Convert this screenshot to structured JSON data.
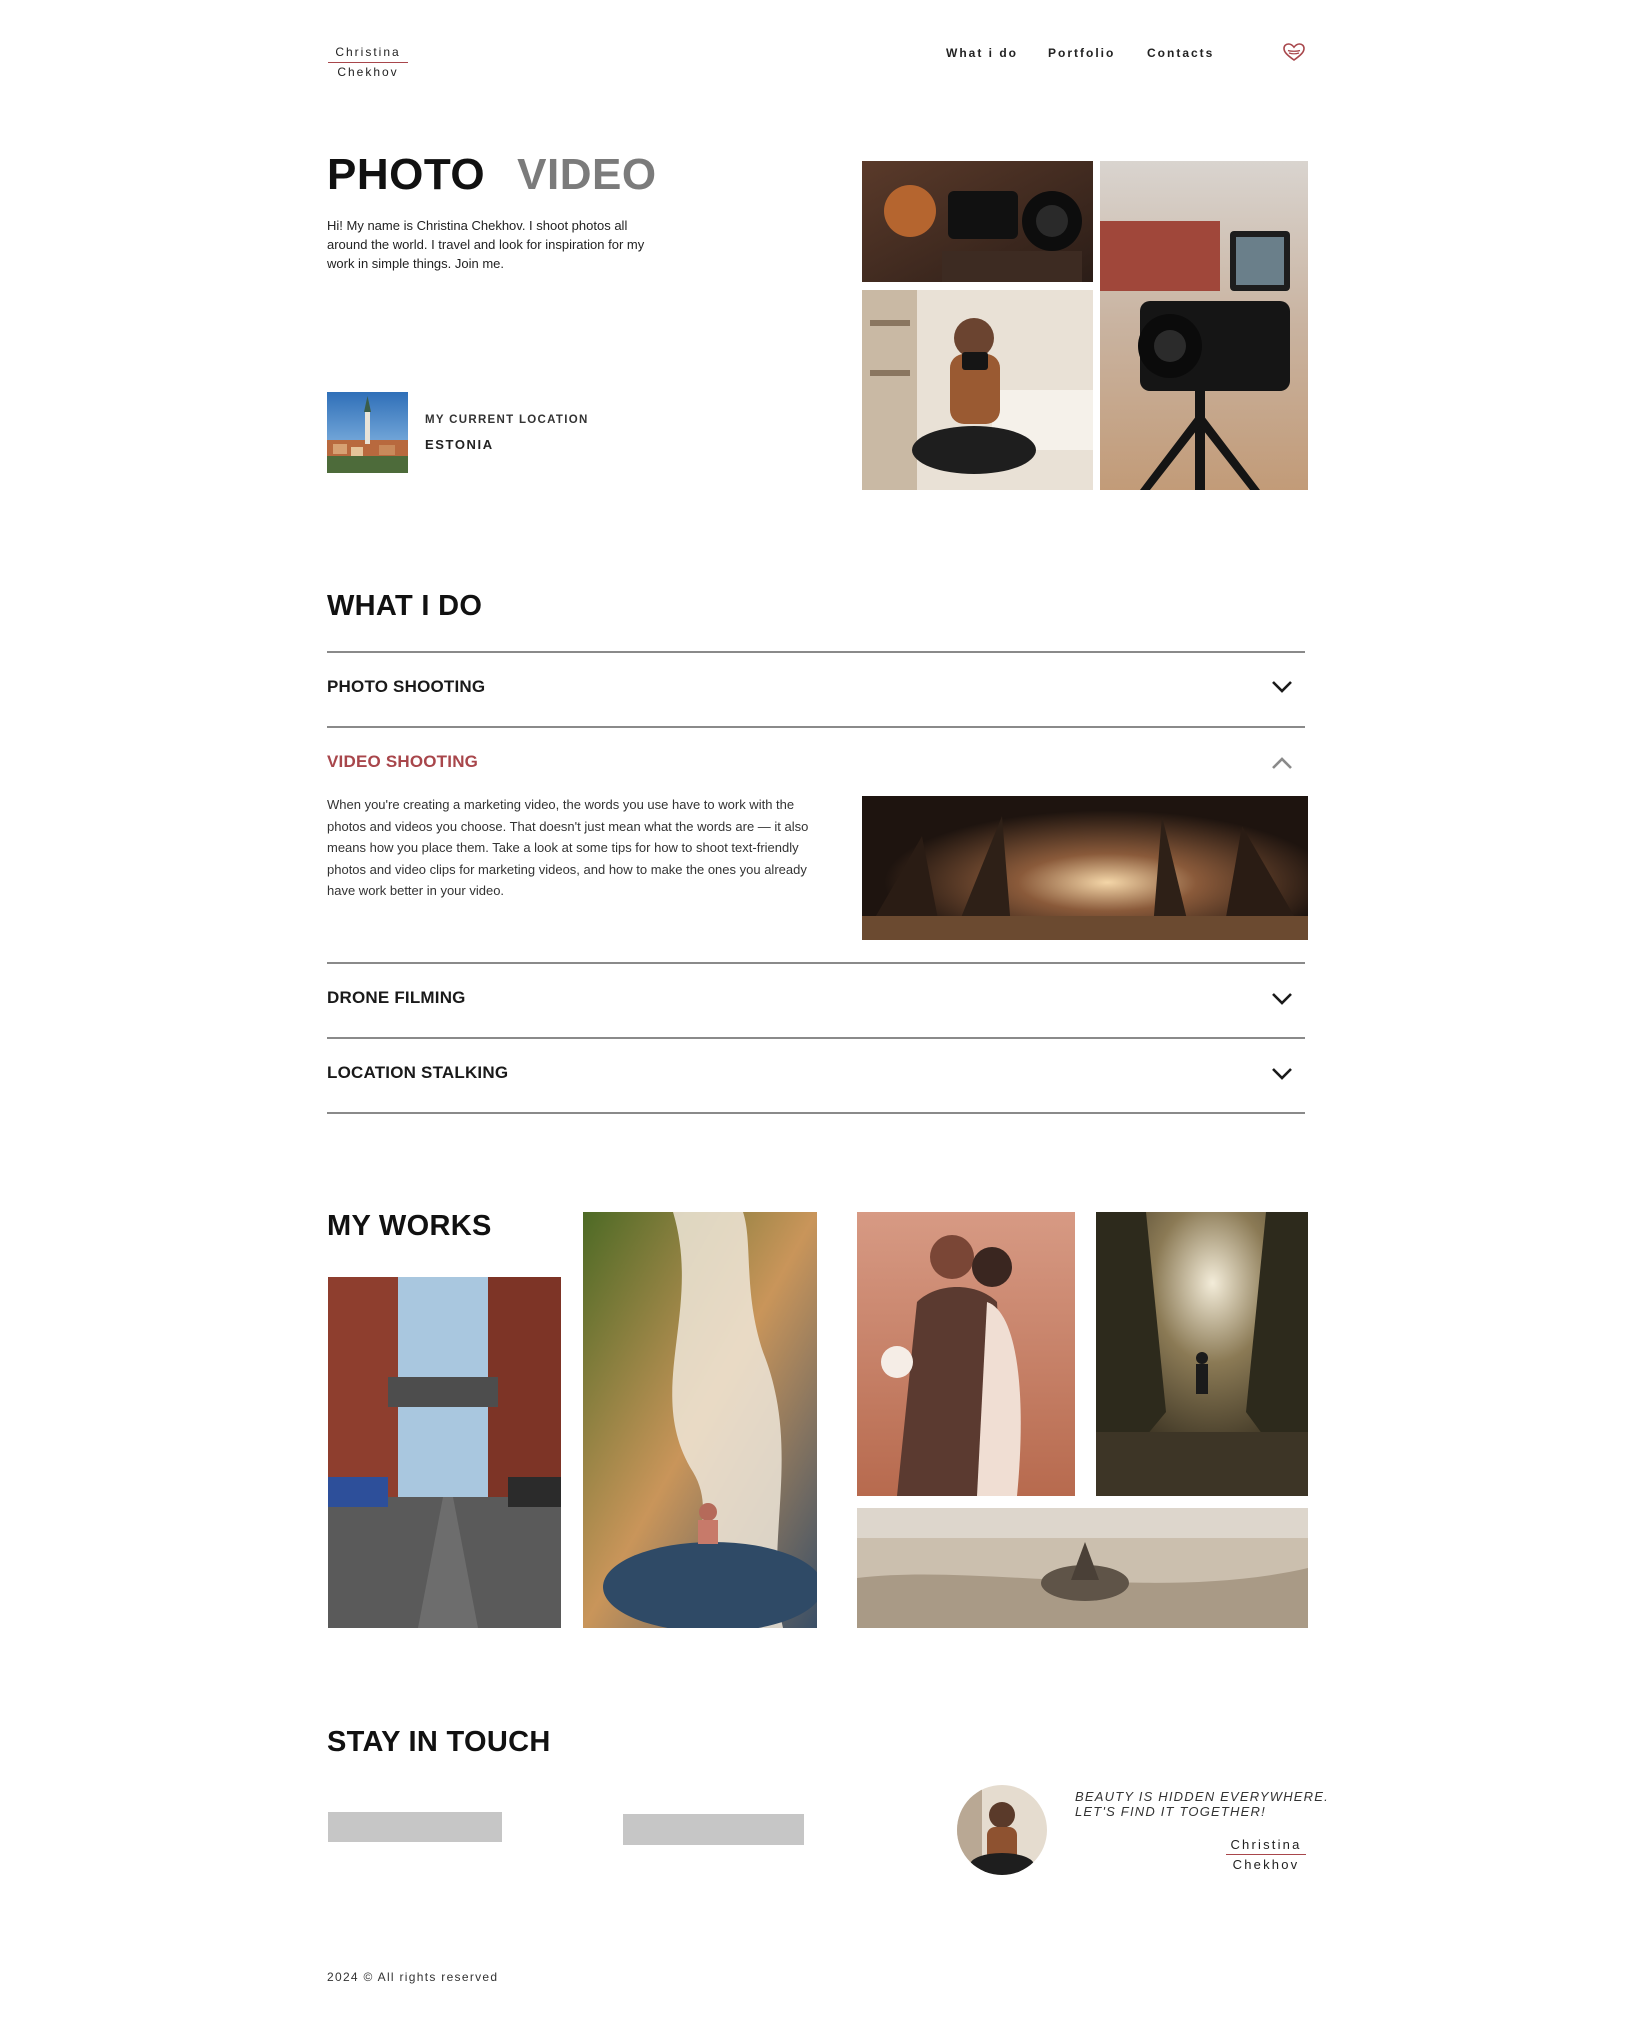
{
  "header": {
    "logo_line1": "Christina",
    "logo_line2": "Chekhov",
    "nav": [
      "What i do",
      "Portfolio",
      "Contacts"
    ],
    "heart_icon": "heart-icon"
  },
  "hero": {
    "title_photo": "PHOTO",
    "title_video": "VIDEO",
    "intro": "Hi! My name is Christina Chekhov. I shoot photos all around the world. I travel and look for inspiration for my work in simple things. Join me.",
    "location_label": "MY CURRENT LOCATION",
    "location_value": "ESTONIA"
  },
  "what_i_do": {
    "title": "WHAT I DO",
    "items": [
      {
        "label": "PHOTO SHOOTING",
        "expanded": false
      },
      {
        "label": "VIDEO SHOOTING",
        "expanded": true,
        "text": "When you're creating a marketing video, the words you use have to work with the photos and videos you choose. That doesn't just mean what the words are — it also means how you place them. Take a look at some tips for how to shoot text-friendly photos and video clips for marketing videos, and how to make the ones you already have work better in your video."
      },
      {
        "label": "DRONE FILMING",
        "expanded": false
      },
      {
        "label": "LOCATION STALKING",
        "expanded": false
      }
    ]
  },
  "works": {
    "title": "MY WORKS"
  },
  "contact": {
    "title": "STAY IN TOUCH",
    "quote_line1": "BEAUTY IS HIDDEN EVERYWHERE.",
    "quote_line2": "LET'S FIND IT TOGETHER!",
    "sign_line1": "Christina",
    "sign_line2": "Chekhov"
  },
  "footer": {
    "copyright": "2024 © All rights reserved"
  },
  "colors": {
    "accent": "#a8464b",
    "muted_title": "#7b7b7b",
    "placeholder_bar": "#c6c6c6"
  }
}
